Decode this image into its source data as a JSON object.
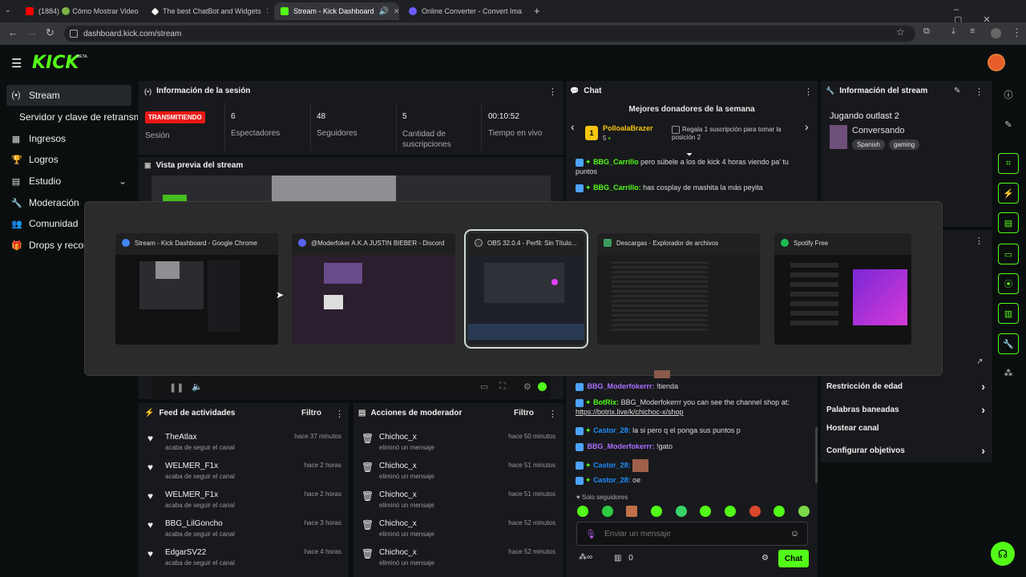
{
  "browser": {
    "tabs": [
      {
        "label": "(1884) 🟢 Cómo Mostrar Video",
        "color": "#ff0000"
      },
      {
        "label": "The best ChatBot and Widgets",
        "color": "#ffffff"
      },
      {
        "label": "Stream - Kick Dashboard",
        "color": "#53fc18"
      },
      {
        "label": "Online Converter - Convert Ima",
        "color": "#6b5cff"
      }
    ],
    "url": "dashboard.kick.com/stream"
  },
  "kick": {
    "logo": "KICK",
    "beta": "BETA"
  },
  "sidebar": {
    "items": [
      {
        "label": "Stream",
        "icon": "(•)"
      },
      {
        "label": "Servidor y clave de retransmi",
        "icon": ""
      },
      {
        "label": "Ingresos",
        "icon": "▦"
      },
      {
        "label": "Logros",
        "icon": "🏆"
      },
      {
        "label": "Estudio",
        "icon": "▤"
      },
      {
        "label": "Moderación",
        "icon": "🔧"
      },
      {
        "label": "Comunidad",
        "icon": "👥"
      },
      {
        "label": "Drops y recom",
        "icon": "🎁"
      }
    ]
  },
  "session": {
    "title": "Información de la sesión",
    "live_badge": "TRANSMITIENDO",
    "live_label": "Sesión",
    "stats": [
      {
        "value": "6",
        "label": "Espectadores"
      },
      {
        "value": "48",
        "label": "Seguidores"
      },
      {
        "value": "5",
        "label": "Cantidad de suscripciones"
      },
      {
        "value": "00:10:52",
        "label": "Tiempo en vivo"
      }
    ]
  },
  "preview": {
    "title": "Vista previa del stream"
  },
  "chat": {
    "title": "Chat",
    "donors_title": "Mejores donadores de la semana",
    "donor_name": "PolloalaBrazer",
    "donor_count": "5",
    "donor_note": "Regala 1 suscripción para tomar la posición 2",
    "top_messages": [
      {
        "user": "BBG_Carrillo",
        "color": "#53fc18",
        "text": "pero súbele a los de kick 4 horas viendo pa' tu puntos"
      },
      {
        "user": "BBG_Carrillo:",
        "color": "#53fc18",
        "text": "has cosplay de mashita la más peyita"
      }
    ],
    "messages": [
      {
        "user": "BBG_Moderfokerrr:",
        "color": "#a970ff",
        "text": "!tienda"
      },
      {
        "user": "BotRix:",
        "color": "#53fc18",
        "text": "BBG_Moderfokerrr you can see the channel shop at:",
        "link": "https://botrix.live/k/chichoc-x/shop"
      },
      {
        "user": "Castor_28:",
        "color": "#1e90ff",
        "text": "la si pero q el ponga sus puntos p"
      },
      {
        "user": "BBG_Moderfokerrr:",
        "color": "#a970ff",
        "text": "!gato"
      },
      {
        "user": "Castor_28:",
        "color": "#1e90ff",
        "text": ""
      },
      {
        "user": "Castor_28:",
        "color": "#1e90ff",
        "text": "oe"
      }
    ],
    "followers_only": "Solo seguidores",
    "input_placeholder": "Enviar un mensaje",
    "points": "0",
    "send": "Chat"
  },
  "stream_info": {
    "title": "Información del stream",
    "stream_title": "Jugando outlast 2",
    "category": "Conversando",
    "tags": [
      "Spanish",
      "gaming"
    ]
  },
  "settings": {
    "items": [
      "Restricción de edad",
      "Palabras baneadas",
      "Hostear canal",
      "Configurar objetivos"
    ]
  },
  "activity": {
    "title": "Feed de actividades",
    "filter": "Filtro",
    "items": [
      {
        "name": "TheAtlax",
        "sub": "acaba de seguir el canal",
        "time": "hace 37 minutos"
      },
      {
        "name": "WELMER_F1x",
        "sub": "acaba de seguir el canal",
        "time": "hace 2 horas"
      },
      {
        "name": "WELMER_F1x",
        "sub": "acaba de seguir el canal",
        "time": "hace 2 horas"
      },
      {
        "name": "BBG_LilGoncho",
        "sub": "acaba de seguir el canal",
        "time": "hace 3 horas"
      },
      {
        "name": "EdgarSV22",
        "sub": "acaba de seguir el canal",
        "time": "hace 4 horas"
      }
    ]
  },
  "modactions": {
    "title": "Acciones de moderador",
    "filter": "Filtro",
    "items": [
      {
        "name": "Chichoc_x",
        "sub": "eliminó un mensaje",
        "time": "hace 50 minutos"
      },
      {
        "name": "Chichoc_x",
        "sub": "eliminó un mensaje",
        "time": "hace 51 minutos"
      },
      {
        "name": "Chichoc_x",
        "sub": "eliminó un mensaje",
        "time": "hace 51 minutos"
      },
      {
        "name": "Chichoc_x",
        "sub": "eliminó un mensaje",
        "time": "hace 52 minutos"
      },
      {
        "name": "Chichoc_x",
        "sub": "eliminó un mensaje",
        "time": "hace 52 minutos"
      }
    ]
  },
  "switcher": {
    "windows": [
      {
        "title": "Stream - Kick Dashboard - Google Chrome",
        "icon_color": "#4285f4"
      },
      {
        "title": "@Moderfoker A.K.A JUSTIN BIEBER - Discord",
        "icon_color": "#5865f2"
      },
      {
        "title": "OBS 32.0.4 - Perfil: Sin Título...",
        "icon_color": "#333333"
      },
      {
        "title": "Descargas - Explorador de archivos",
        "icon_color": "#3a9d5d"
      },
      {
        "title": "Spotify Free",
        "icon_color": "#1db954"
      }
    ]
  },
  "colors": {
    "accent": "#53fc18",
    "live": "#e91916"
  }
}
